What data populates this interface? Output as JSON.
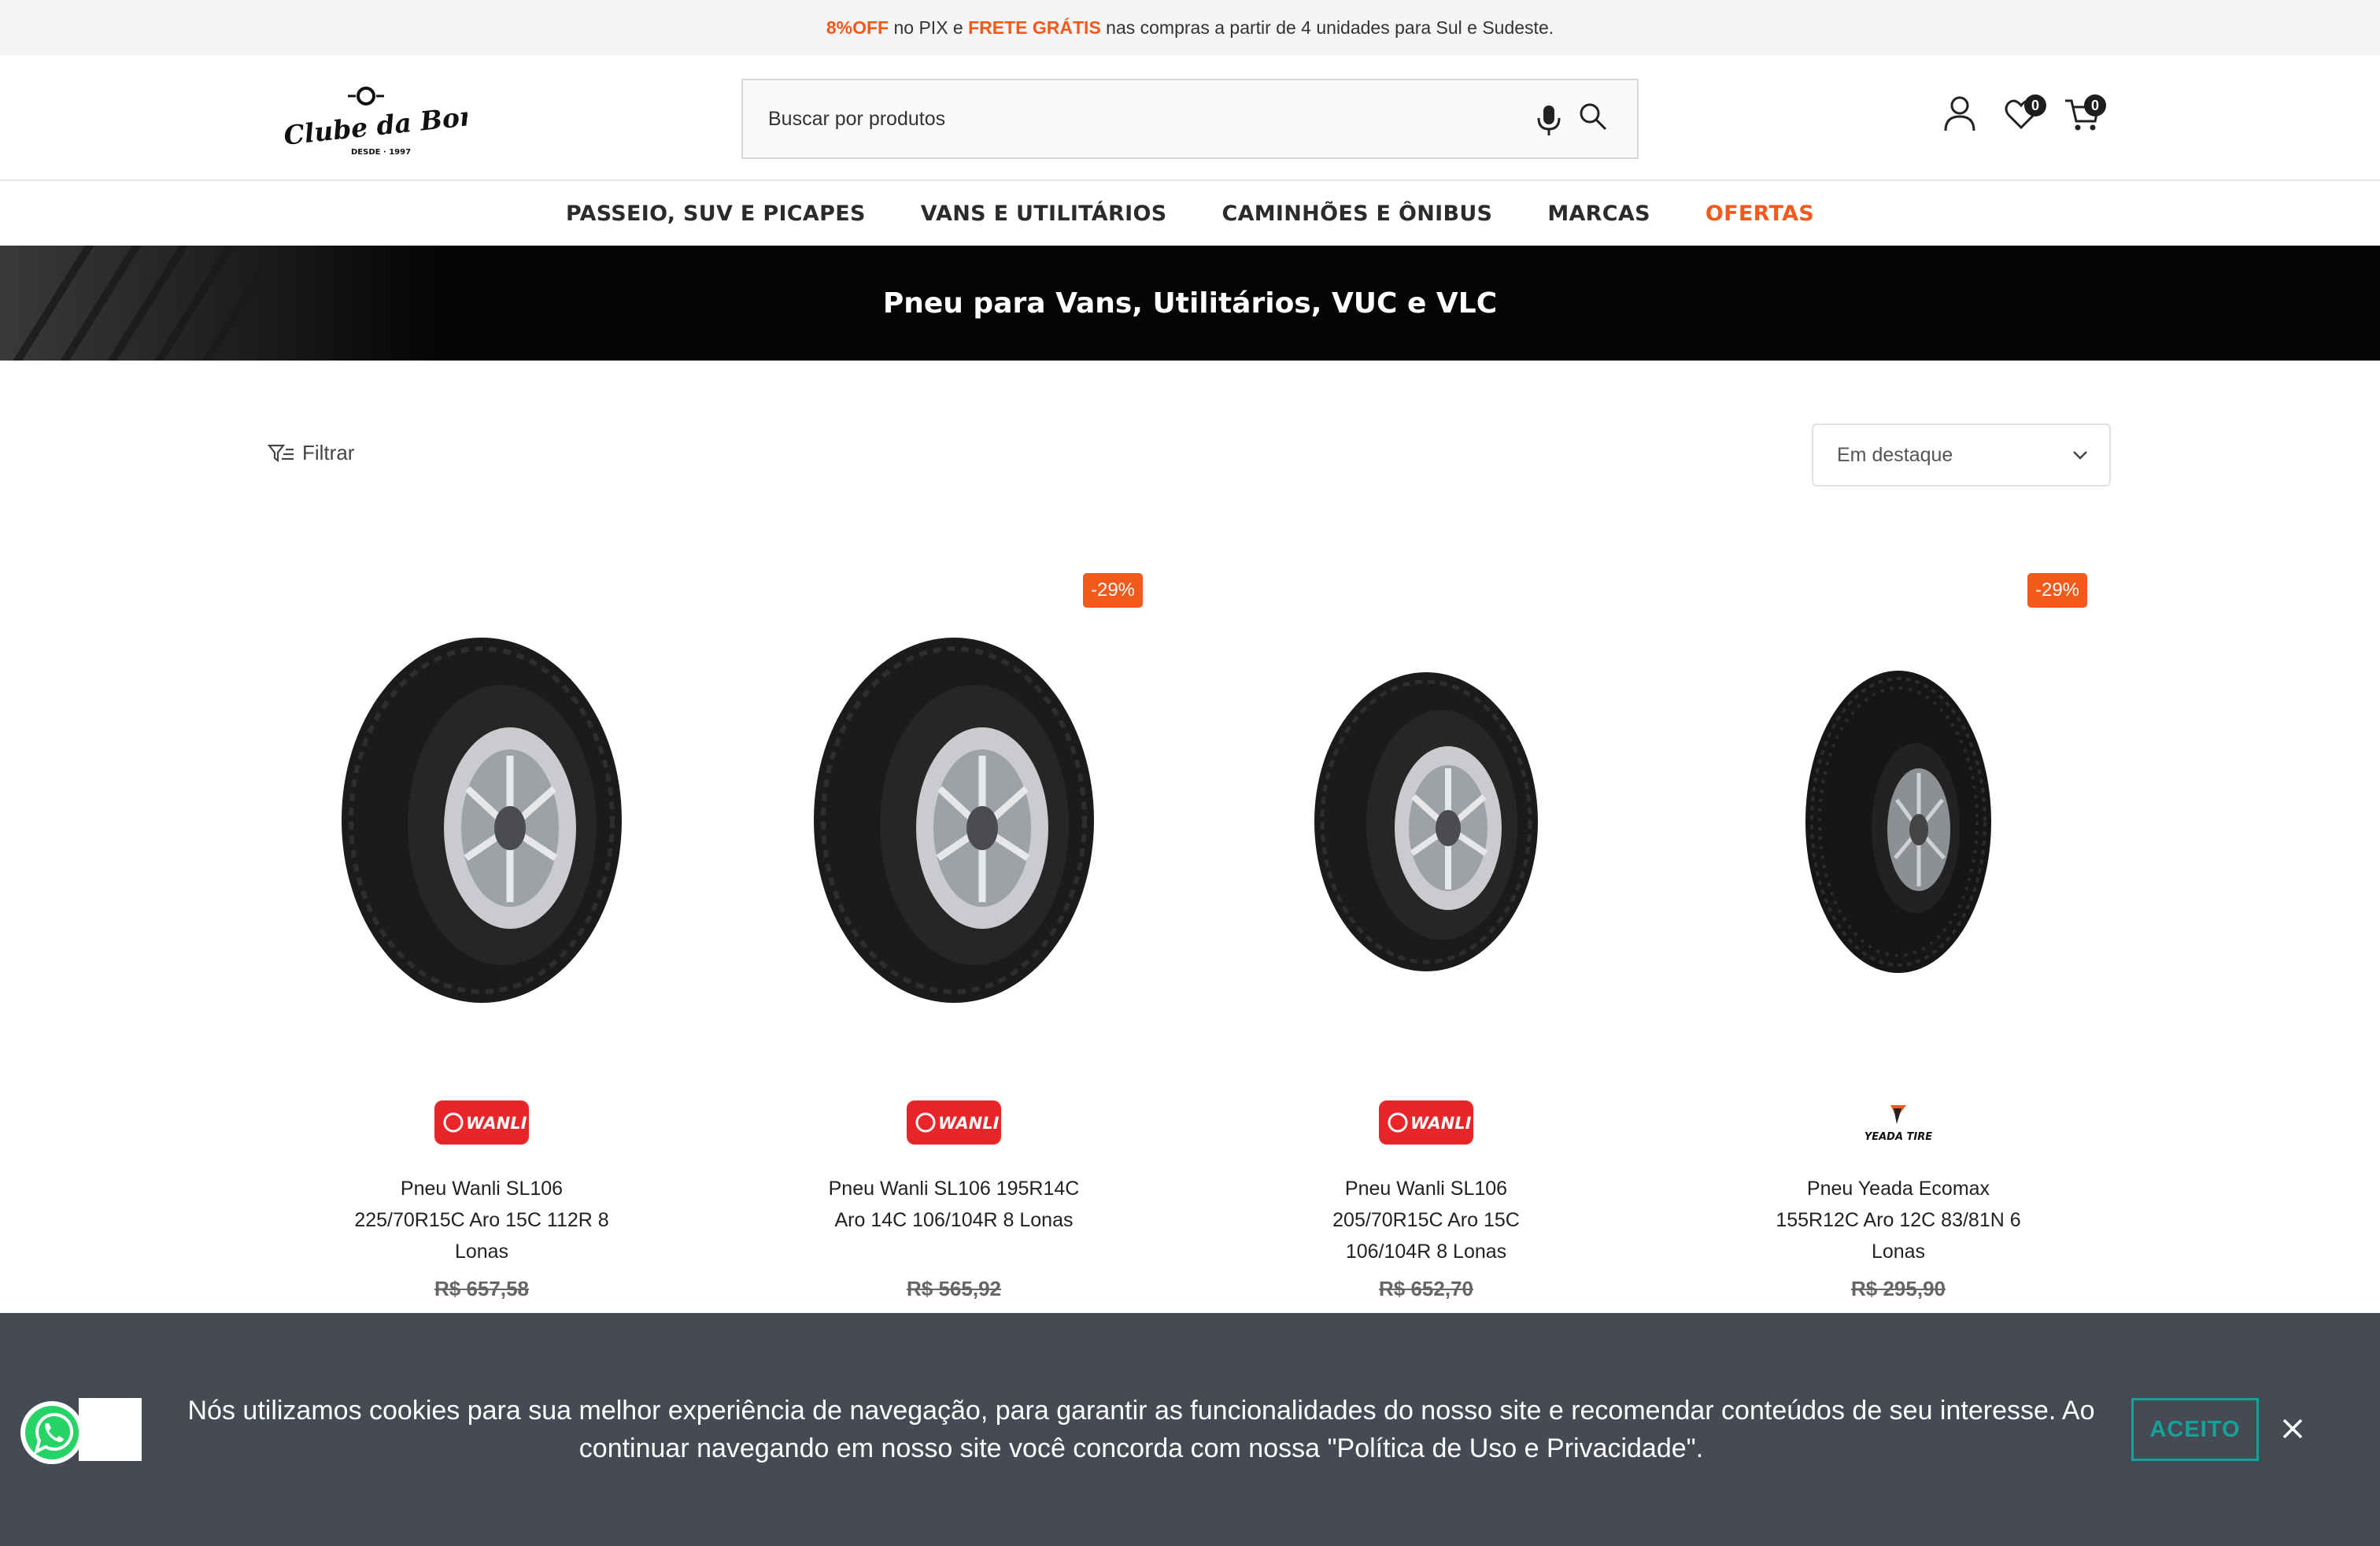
{
  "promo": {
    "part1": "8%OFF",
    "part2": " no PIX e ",
    "part3": "FRETE GRÁTIS",
    "part4": " nas compras a partir de 4 unidades para Sul e Sudeste."
  },
  "header": {
    "logo": {
      "line1": "Clube da Borracha",
      "line2": "DESDE · 1997"
    },
    "search_placeholder": "Buscar por produtos",
    "wishlist_count": "0",
    "cart_count": "0"
  },
  "nav": {
    "items": [
      "PASSEIO, SUV E PICAPES",
      "VANS E UTILITÁRIOS",
      "CAMINHÕES E ÔNIBUS",
      "MARCAS",
      "OFERTAS"
    ]
  },
  "hero": {
    "title": "Pneu para Vans, Utilitários, VUC e VLC"
  },
  "toolbar": {
    "filter_label": "Filtrar",
    "sort_value": "Em destaque"
  },
  "products": [
    {
      "discount": "",
      "brand": "WANLI",
      "title_lines": [
        "Pneu Wanli SL106",
        "225/70R15C Aro 15C 112R 8",
        "Lonas"
      ],
      "price": "R$ 657,58"
    },
    {
      "discount": "-29%",
      "brand": "WANLI",
      "title_lines": [
        "Pneu Wanli SL106 195R14C",
        "Aro 14C 106/104R 8 Lonas",
        ""
      ],
      "price": "R$ 565,92"
    },
    {
      "discount": "",
      "brand": "WANLI",
      "title_lines": [
        "Pneu Wanli SL106",
        "205/70R15C Aro 15C",
        "106/104R 8 Lonas"
      ],
      "price": "R$ 652,70"
    },
    {
      "discount": "-29%",
      "brand": "YEADA TIRE",
      "title_lines": [
        "Pneu Yeada Ecomax",
        "155R12C Aro 12C 83/81N 6",
        "Lonas"
      ],
      "price": "R$ 295,90"
    }
  ],
  "cookie": {
    "text": "Nós utilizamos cookies para sua melhor experiência de navegação, para garantir as funcionalidades do nosso site e recomendar conteúdos de seu interesse. Ao continuar navegando em nosso site você concorda com nossa \"Política de Uso e Privacidade\".",
    "accept_label": "ACEITO"
  },
  "colors": {
    "accent": "#f2591b",
    "cookie_bg": "#464a55",
    "accept": "#14a39b",
    "brand_wanli": "#e8262a"
  },
  "icons": [
    "microphone-icon",
    "search-icon",
    "user-icon",
    "heart-icon",
    "cart-icon",
    "filter-icon",
    "chevron-down-icon",
    "whatsapp-icon",
    "close-icon"
  ]
}
